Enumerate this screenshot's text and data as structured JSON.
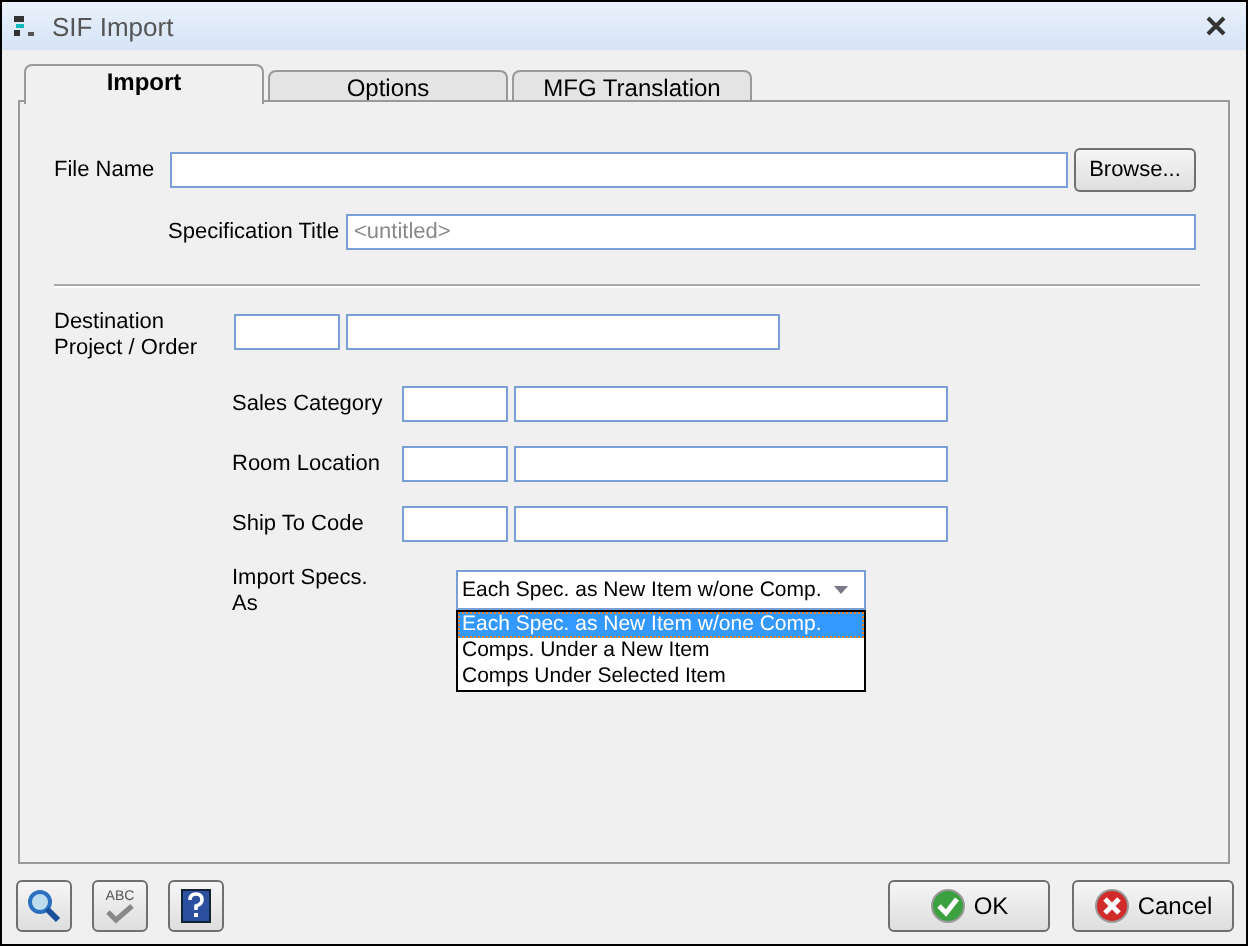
{
  "window": {
    "title": "SIF Import"
  },
  "tabs": [
    {
      "label": "Import",
      "selected": true
    },
    {
      "label": "Options",
      "selected": false
    },
    {
      "label": "MFG Translation",
      "selected": false
    }
  ],
  "file_name": {
    "label": "File Name"
  },
  "browse_button": "Browse...",
  "specification_title": {
    "label": "Specification Title",
    "placeholder": "<untitled>"
  },
  "destination": {
    "label": "Destination Project / Order"
  },
  "sub_fields": [
    {
      "label": "Sales Category"
    },
    {
      "label": "Room Location"
    },
    {
      "label": "Ship To Code"
    }
  ],
  "import_specs_as": {
    "label": "Import Specs. As",
    "value": "Each Spec. as New Item w/one Comp.",
    "expanded": true,
    "options": [
      {
        "label": "Each Spec. as New Item w/one Comp.",
        "selected": true
      },
      {
        "label": "Comps. Under a New Item",
        "selected": false
      },
      {
        "label": "Comps Under Selected Item",
        "selected": false
      }
    ]
  },
  "toolbar": {
    "spellcheck_text": "ABC"
  },
  "buttons": [
    {
      "kind": "ok",
      "label": "OK"
    },
    {
      "kind": "cancel",
      "label": "Cancel"
    }
  ]
}
